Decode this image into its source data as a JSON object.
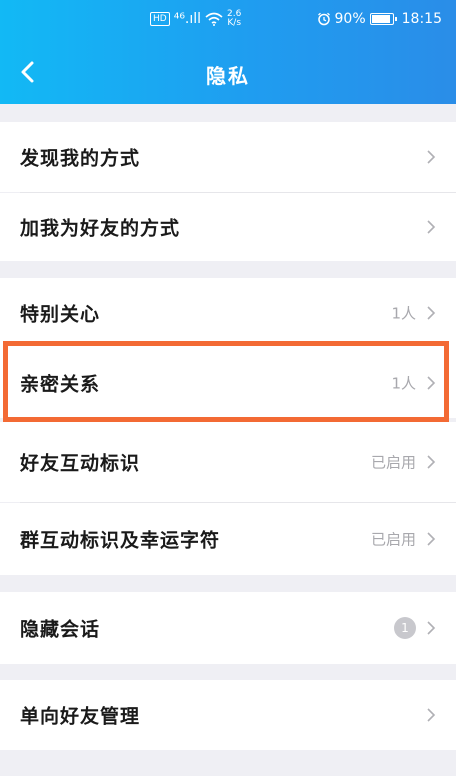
{
  "status_bar": {
    "hd": "HD",
    "signal": "⁴⁶.ıll",
    "net_speed": "2.6",
    "net_unit": "K/s",
    "battery": "90%",
    "time": "18:15"
  },
  "nav": {
    "title": "隐私"
  },
  "rows": [
    {
      "label": "发现我的方式",
      "value": ""
    },
    {
      "label": "加我为好友的方式",
      "value": ""
    },
    {
      "label": "特别关心",
      "value": "1人"
    },
    {
      "label": "亲密关系",
      "value": "1人"
    },
    {
      "label": "好友互动标识",
      "value": "已启用"
    },
    {
      "label": "群互动标识及幸运字符",
      "value": "已启用"
    },
    {
      "label": "隐藏会话",
      "badge": "1"
    },
    {
      "label": "单向好友管理",
      "value": ""
    }
  ],
  "colors": {
    "header_start": "#12b9f5",
    "header_end": "#2a8de8",
    "highlight": "#f36a34",
    "secondary_text": "#a8a8ad"
  }
}
